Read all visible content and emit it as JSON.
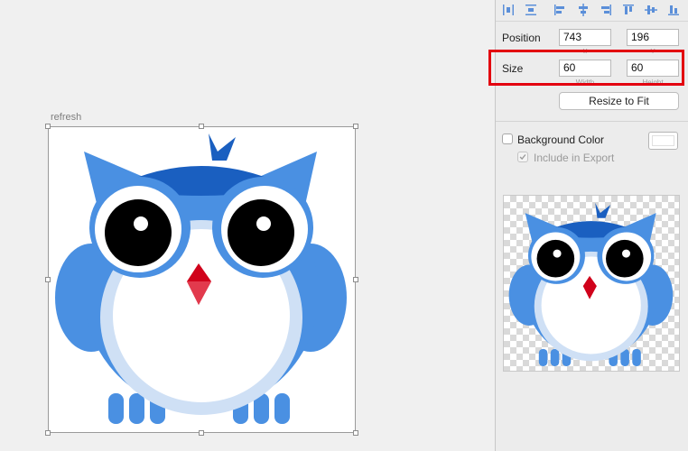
{
  "canvas": {
    "artboard_label": "refresh"
  },
  "inspector": {
    "alignment_icons": [
      "distribute-horizontal-icon",
      "distribute-vertical-icon",
      "align-left-icon",
      "align-center-horizontal-icon",
      "align-right-icon",
      "align-top-icon",
      "align-middle-vertical-icon",
      "align-bottom-icon"
    ],
    "position": {
      "label": "Position",
      "x": "743",
      "y": "196",
      "x_caption": "X",
      "y_caption": "Y"
    },
    "size": {
      "label": "Size",
      "width": "60",
      "height": "60",
      "width_caption": "Width",
      "height_caption": "Height"
    },
    "resize_button": "Resize to Fit",
    "background_color": {
      "label": "Background Color",
      "checked": false,
      "color": "#ffffff"
    },
    "include_in_export": {
      "label": "Include in Export",
      "checked": true,
      "enabled": false
    }
  },
  "colors": {
    "owl_blue": "#4a90e2",
    "owl_dark_blue": "#1a5fc0",
    "belly_ring": "#cfe0f5",
    "beak": "#d0021b",
    "highlight": "#e3000f"
  }
}
